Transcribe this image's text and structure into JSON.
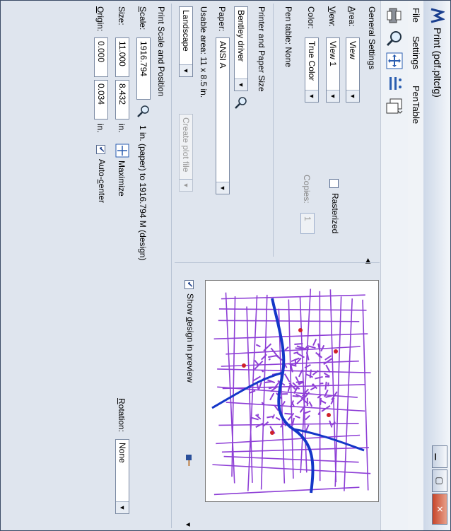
{
  "window": {
    "title": "Print (pdf.pltcfg)"
  },
  "menu": {
    "file": "File",
    "settings": "Settings",
    "pentable": "PenTable"
  },
  "toolbar": {
    "icons": [
      "printer-icon",
      "preview-zoom-icon",
      "fit-view-icon",
      "properties-icon",
      "layout-icon"
    ]
  },
  "general": {
    "title": "General Settings",
    "area_label": "Area:",
    "area_value": "View",
    "view_label": "View:",
    "view_value": "View 1",
    "color_label": "Color:",
    "color_value": "True Color",
    "pen_table": "Pen table:  None",
    "rasterized": "Rasterized",
    "copies_label": "Copies:",
    "copies_value": "1"
  },
  "printer": {
    "title": "Printer and Paper Size",
    "driver_value": "Bentley driver",
    "paper_label": "Paper:",
    "paper_value": "ANSI A",
    "usable_area": "Usable area:  11 x 8.5 in.",
    "orientation_value": "Landscape",
    "create_plot_file": "Create plot file"
  },
  "preview": {
    "show_design": "Show design in preview"
  },
  "scale": {
    "title": "Print Scale and Position",
    "scale_label": "Scale:",
    "scale_value": "1916.794",
    "scale_text": "1 in. (paper) to 1916.794 M  (design)",
    "size_label": "Size:",
    "size_w": "11.000",
    "size_h": "8.432",
    "size_unit": "in.",
    "maximize": "Maximize",
    "origin_label": "Origin:",
    "origin_x": "0.000",
    "origin_y": "0.034",
    "origin_unit": "in.",
    "autocenter": "Auto-center",
    "rotation_label": "Rotation:",
    "rotation_value": "None"
  },
  "colors": {
    "map_road": "#8e3fd6",
    "map_water": "#1436c8",
    "map_red": "#d0202a"
  }
}
